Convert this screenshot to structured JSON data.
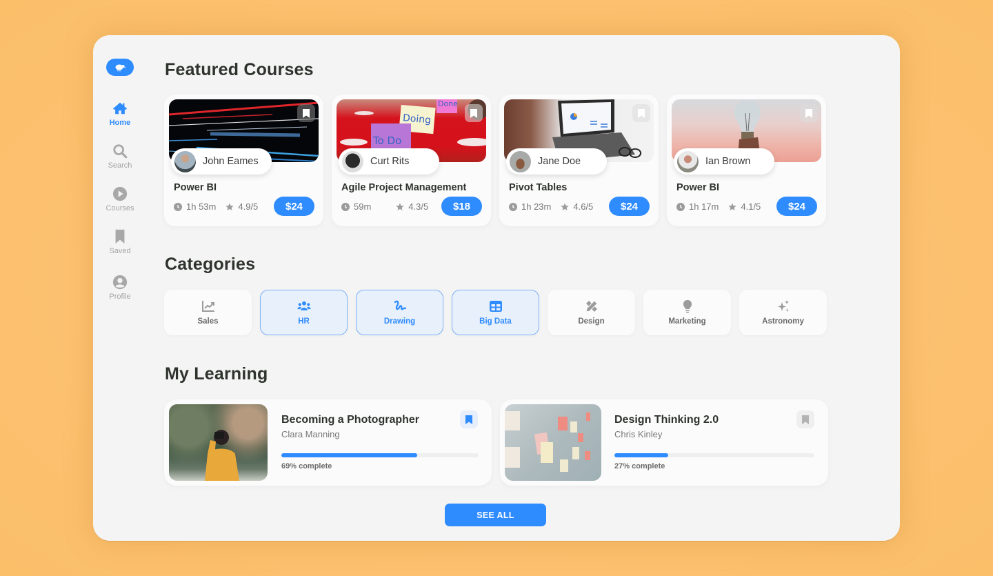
{
  "colors": {
    "accent": "#2f8cff",
    "background": "#fcc170",
    "panel": "#f4f4f4"
  },
  "sidebar": {
    "logo_icon": "kiwi-bird-icon",
    "items": [
      {
        "label": "Home",
        "icon": "home-icon",
        "active": true
      },
      {
        "label": "Search",
        "icon": "search-icon",
        "active": false
      },
      {
        "label": "Courses",
        "icon": "play-circle-icon",
        "active": false
      },
      {
        "label": "Saved",
        "icon": "bookmark-icon",
        "active": false
      },
      {
        "label": "Profile",
        "icon": "user-circle-icon",
        "active": false
      }
    ]
  },
  "featured": {
    "title": "Featured Courses",
    "courses": [
      {
        "title": "Power BI",
        "author": "John Eames",
        "duration": "1h 53m",
        "rating": "4.9/5",
        "price": "$24",
        "image": "light-streaks"
      },
      {
        "title": "Agile Project Management",
        "author": "Curt Rits",
        "duration": "59m",
        "rating": "4.3/5",
        "price": "$18",
        "image": "sticky-notes-todo-doing-done"
      },
      {
        "title": "Pivot Tables",
        "author": "Jane Doe",
        "duration": "1h 23m",
        "rating": "4.6/5",
        "price": "$24",
        "image": "laptop-dashboard"
      },
      {
        "title": "Power BI",
        "author": "Ian Brown",
        "duration": "1h 17m",
        "rating": "4.1/5",
        "price": "$24",
        "image": "lightbulb"
      }
    ],
    "image_text": {
      "todo": "To Do",
      "doing": "Doing",
      "done": "Done"
    }
  },
  "categories": {
    "title": "Categories",
    "items": [
      {
        "label": "Sales",
        "icon": "chart-line-icon",
        "selected": false
      },
      {
        "label": "HR",
        "icon": "users-icon",
        "selected": true
      },
      {
        "label": "Drawing",
        "icon": "signature-icon",
        "selected": true
      },
      {
        "label": "Big Data",
        "icon": "table-icon",
        "selected": true
      },
      {
        "label": "Design",
        "icon": "pencil-ruler-icon",
        "selected": false
      },
      {
        "label": "Marketing",
        "icon": "lightbulb-icon",
        "selected": false
      },
      {
        "label": "Astronomy",
        "icon": "sparkles-icon",
        "selected": false
      }
    ]
  },
  "learning": {
    "title": "My Learning",
    "items": [
      {
        "title": "Becoming a Photographer",
        "instructor": "Clara Manning",
        "progress": 69,
        "progress_label": "69% complete",
        "saved": true
      },
      {
        "title": "Design Thinking 2.0",
        "instructor": "Chris Kinley",
        "progress": 27,
        "progress_label": "27% complete",
        "saved": false
      }
    ]
  },
  "see_all_label": "SEE ALL"
}
